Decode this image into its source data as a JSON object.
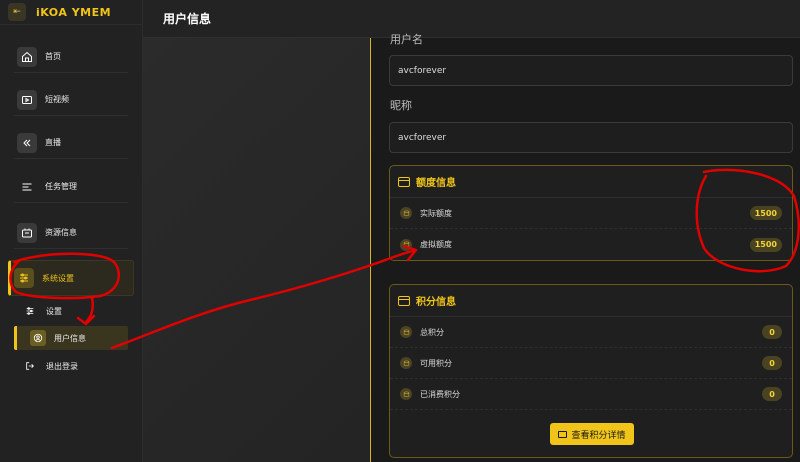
{
  "app": {
    "brand": "iKOA YMEM"
  },
  "header": {
    "title": "用户信息"
  },
  "sidebar": {
    "items": [
      {
        "label": "首页",
        "icon": "home-icon"
      },
      {
        "label": "短视频",
        "icon": "video-icon"
      },
      {
        "label": "直播",
        "icon": "live-icon"
      },
      {
        "label": "任务管理",
        "icon": "task-list-icon"
      },
      {
        "label": "资源信息",
        "icon": "resource-icon"
      },
      {
        "label": "系统设置",
        "icon": "sliders-icon",
        "active": true
      }
    ],
    "sub_items": [
      {
        "label": "设置",
        "icon": "settings-sliders-icon"
      },
      {
        "label": "用户信息",
        "icon": "user-icon",
        "active": true
      },
      {
        "label": "退出登录",
        "icon": "logout-icon"
      }
    ]
  },
  "form": {
    "username_label": "用户名",
    "username_value": "avcforever",
    "nickname_label": "昵称",
    "nickname_value": "avcforever"
  },
  "quota": {
    "title": "额度信息",
    "rows": [
      {
        "label": "实际额度",
        "value": "1500"
      },
      {
        "label": "虚拟额度",
        "value": "1500"
      }
    ]
  },
  "points": {
    "title": "积分信息",
    "rows": [
      {
        "label": "总积分",
        "value": "0"
      },
      {
        "label": "可用积分",
        "value": "0"
      },
      {
        "label": "已消费积分",
        "value": "0"
      }
    ],
    "button_label": "查看积分详情"
  },
  "colors": {
    "accent": "#f0c419",
    "annotation": "#e00000"
  }
}
